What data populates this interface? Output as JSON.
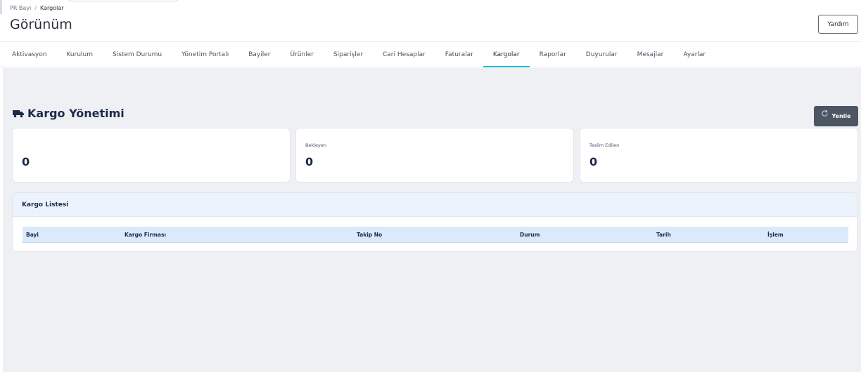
{
  "breadcrumb": {
    "root": "PR Bayi",
    "separator": "/",
    "current": "Kargolar"
  },
  "page": {
    "title": "Görünüm",
    "help_label": "Yardım"
  },
  "tabs": [
    {
      "label": "Aktivasyon"
    },
    {
      "label": "Kurulum"
    },
    {
      "label": "Sistem Durumu"
    },
    {
      "label": "Yönetim Portalı"
    },
    {
      "label": "Bayiler"
    },
    {
      "label": "Ürünler"
    },
    {
      "label": "Siparişler"
    },
    {
      "label": "Cari Hesaplar"
    },
    {
      "label": "Faturalar"
    },
    {
      "label": "Kargolar",
      "active": true
    },
    {
      "label": "Raporlar"
    },
    {
      "label": "Duyurular"
    },
    {
      "label": "Mesajlar"
    },
    {
      "label": "Ayarlar"
    }
  ],
  "section": {
    "title": "Kargo Yönetimi",
    "icon": "truck-icon",
    "refresh_label": "Yenile",
    "refresh_icon": "refresh-icon"
  },
  "stats": [
    {
      "label": "",
      "value": "0"
    },
    {
      "label": "Bekleyen",
      "value": "0"
    },
    {
      "label": "Teslim Edilen",
      "value": "0"
    }
  ],
  "list": {
    "title": "Kargo Listesi",
    "columns": [
      "Bayi",
      "Kargo Firması",
      "Takip No",
      "Durum",
      "Tarih",
      "İşlem"
    ]
  },
  "colors": {
    "accent": "#22b7d8",
    "heading": "#1b2a4a",
    "button_dark": "#4c5562",
    "background": "#eef0f3"
  }
}
